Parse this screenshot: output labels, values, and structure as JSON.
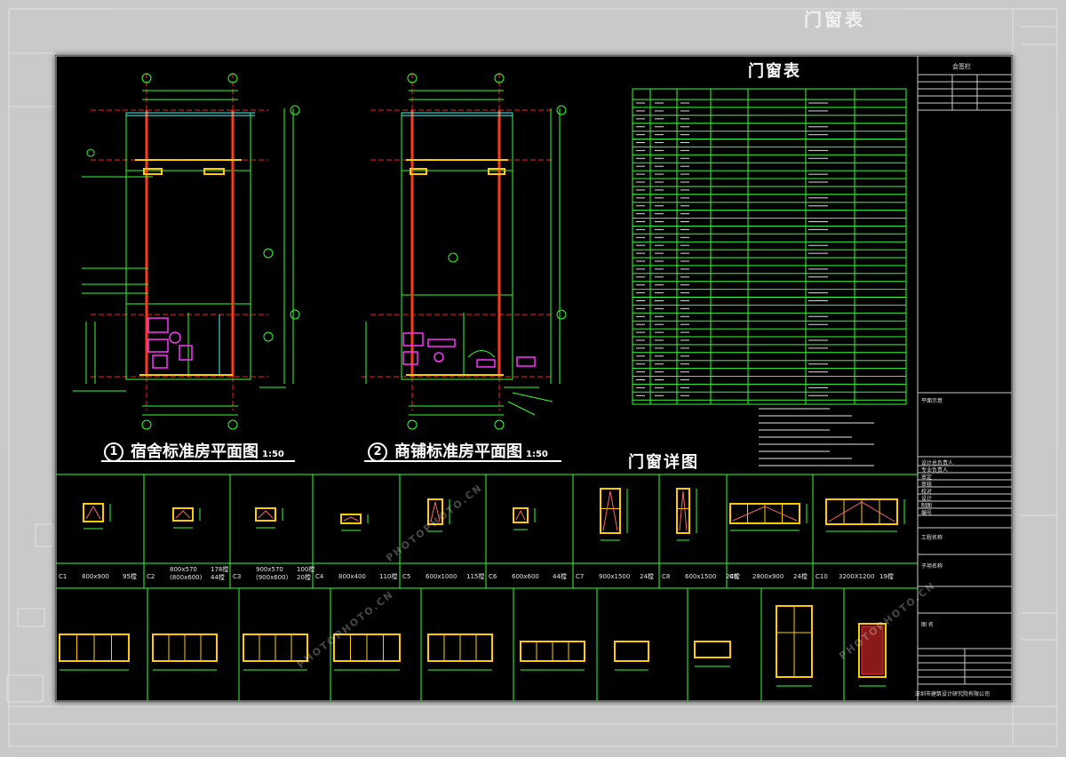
{
  "background": {
    "ghost_title": "门窗表",
    "color": "#c9c9c9"
  },
  "colors": {
    "sheet_bg": "#000000",
    "line_green": "#33ff33",
    "axis_red": "#ff2020",
    "wall_yellow": "#ffcc00",
    "fixture_magenta": "#ff33ff",
    "text_white": "#ffffff",
    "cyan": "#33ffff"
  },
  "plans": [
    {
      "num": "1",
      "title": "宿舍标准房平面图",
      "scale": "1:50"
    },
    {
      "num": "2",
      "title": "商铺标准房平面图",
      "scale": "1:50"
    }
  ],
  "schedule": {
    "title": "门窗表",
    "detail_title": "门窗详图"
  },
  "titleblock": {
    "header": "会签栏",
    "key_plan": "平面示意",
    "roles": [
      "设计总负责人",
      "专业负责人",
      "审定",
      "审核",
      "校对",
      "设计",
      "制图",
      "编号"
    ],
    "project_label": "工程名称",
    "sub_label": "子项名称",
    "drawing_label": "图 名",
    "company": "深圳市建筑设计研究院有限公司"
  },
  "details_row1": [
    {
      "code": "C1",
      "size": "800x900",
      "qty": "95樘"
    },
    {
      "code": "C2",
      "size": "800x570\n(800x600)",
      "qty": "178樘\n44樘"
    },
    {
      "code": "C3",
      "size": "900x570\n(900x600)",
      "qty": "100樘\n20樘"
    },
    {
      "code": "C4",
      "size": "800x400",
      "qty": "110樘"
    },
    {
      "code": "C5",
      "size": "600x1000",
      "qty": "115樘"
    },
    {
      "code": "C6",
      "size": "600x600",
      "qty": "44樘"
    },
    {
      "code": "C7",
      "size": "900x1500",
      "qty": "24樘"
    },
    {
      "code": "C8",
      "size": "600x1500",
      "qty": "24樘"
    },
    {
      "code": "C9",
      "size": "2800x900",
      "qty": "24樘"
    },
    {
      "code": "C10",
      "size": "3200X1200",
      "qty": "19樘"
    }
  ],
  "watermark": {
    "brand": "PHOTOPHOTO.CN"
  }
}
